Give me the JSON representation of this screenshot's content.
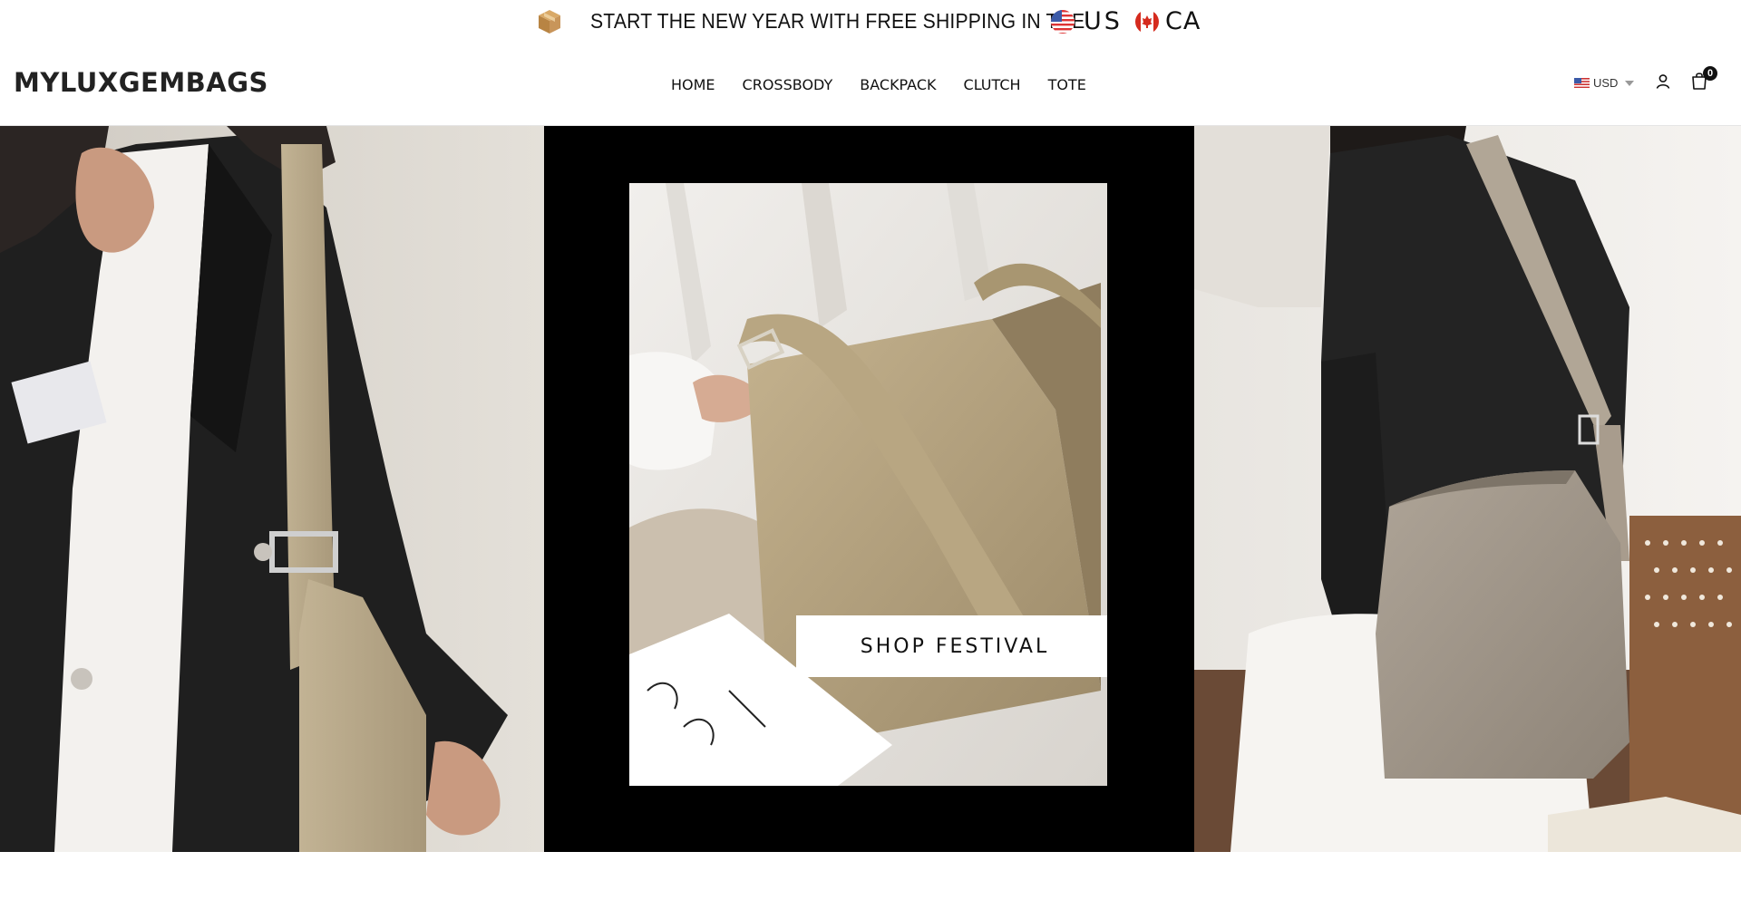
{
  "announcement": {
    "message": "START THE NEW YEAR WITH FREE SHIPPING IN THE",
    "country_1": "US",
    "country_2": "CA",
    "icons": [
      "package-icon",
      "us-flag-icon",
      "canada-flag-icon"
    ]
  },
  "header": {
    "logo": "MYLUXGEMBAGS",
    "nav": [
      "HOME",
      "CROSSBODY",
      "BACKPACK",
      "CLUTCH",
      "TOTE"
    ],
    "currency": "USD",
    "cart_count": "0",
    "icons": [
      "us-flag-icon",
      "chevron-down-icon",
      "user-icon",
      "shopping-bag-icon"
    ]
  },
  "hero": {
    "cta_label": "SHOP FESTIVAL",
    "colors": {
      "center_background": "#000000",
      "bag_tan": "#b3a27f",
      "blazer_black": "#1c1c1c"
    }
  }
}
